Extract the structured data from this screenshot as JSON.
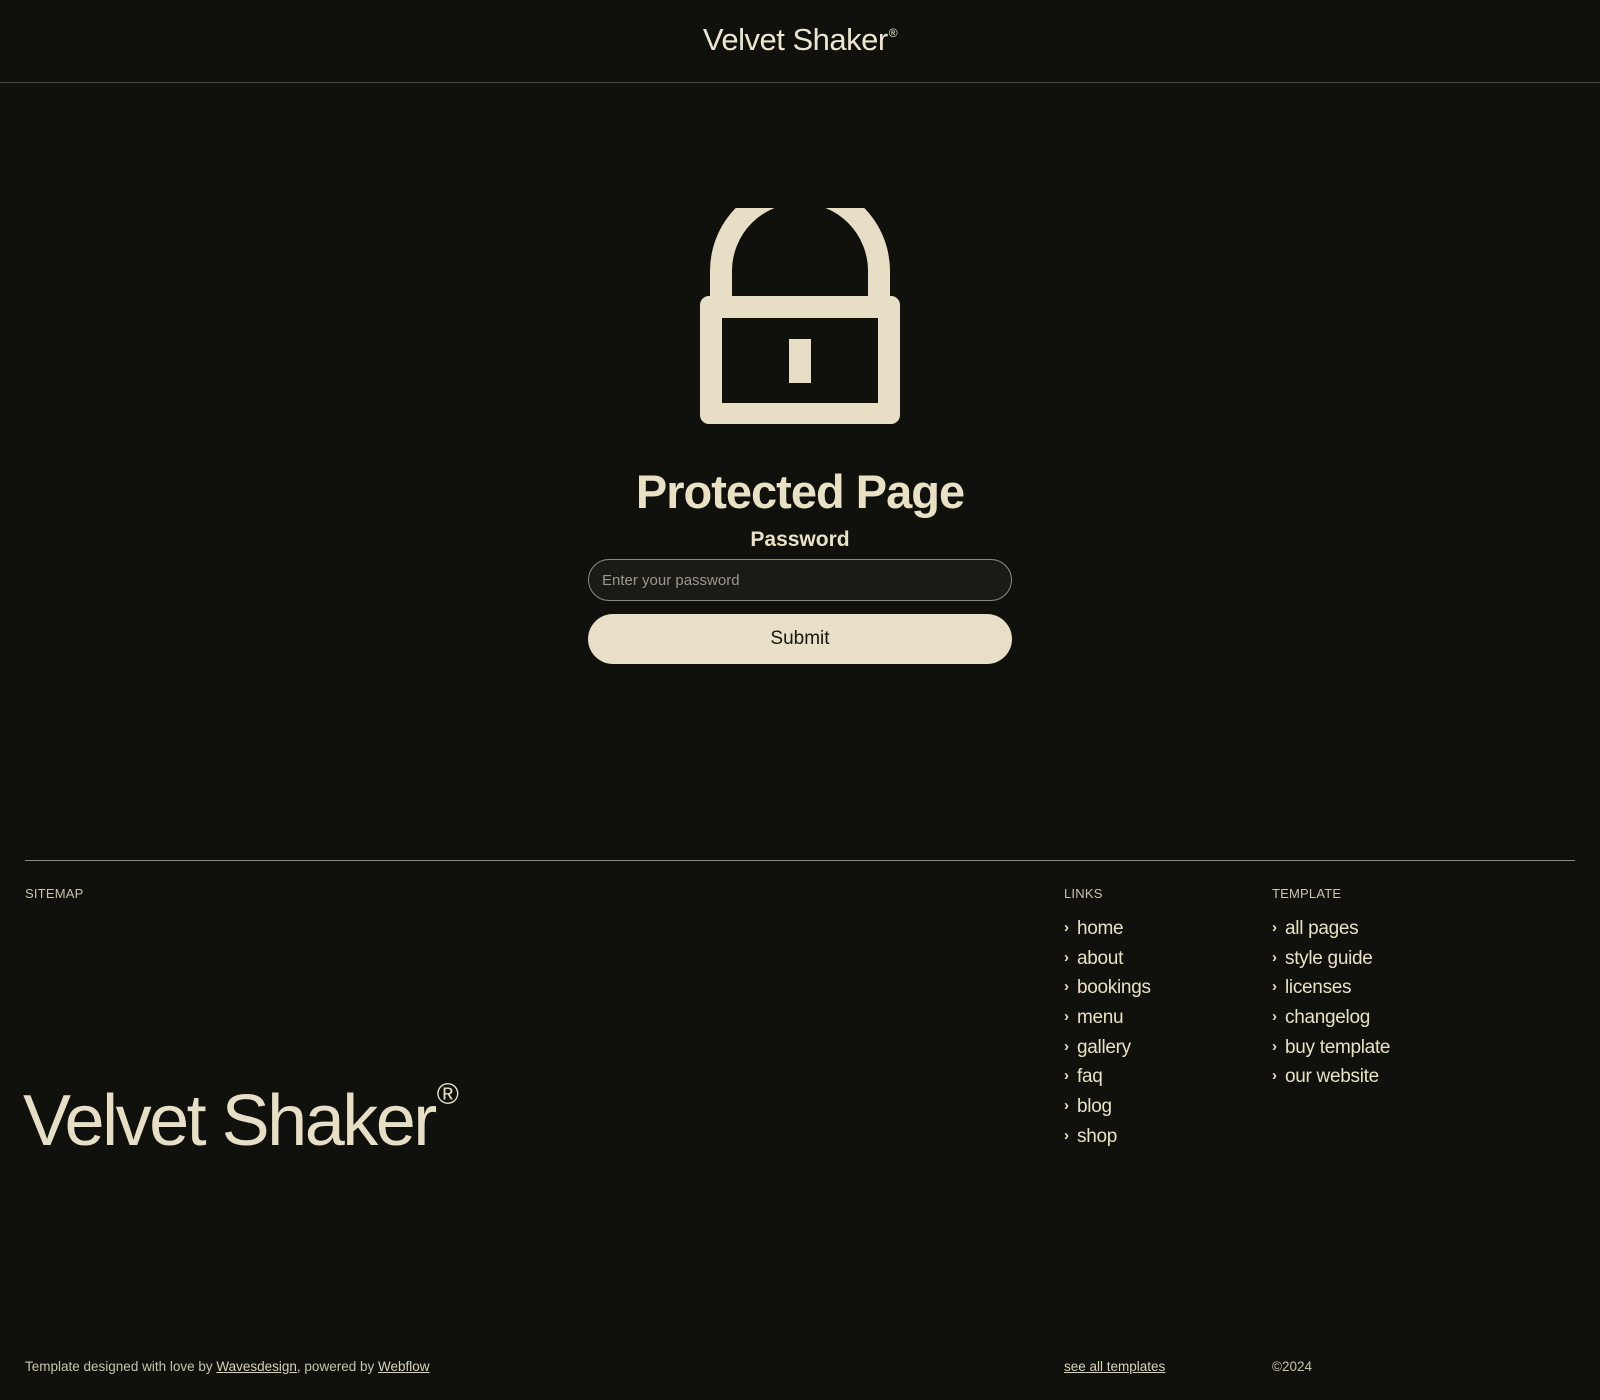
{
  "header": {
    "brand": "Velvet Shaker",
    "reg_mark": "®"
  },
  "lock": {
    "icon": "lock-icon",
    "color": "#e6dfc6"
  },
  "form": {
    "title": "Protected Page",
    "password_label": "Password",
    "password_placeholder": "Enter your password",
    "password_value": "",
    "submit_label": "Submit"
  },
  "footer": {
    "sitemap_heading": "SITEMAP",
    "links_heading": "LINKS",
    "template_heading": "TEMPLATE",
    "links": [
      {
        "label": "home"
      },
      {
        "label": "about"
      },
      {
        "label": "bookings"
      },
      {
        "label": "menu"
      },
      {
        "label": "gallery"
      },
      {
        "label": "faq"
      },
      {
        "label": "blog"
      },
      {
        "label": "shop"
      }
    ],
    "template_links": [
      {
        "label": "all pages"
      },
      {
        "label": "style guide"
      },
      {
        "label": "licenses"
      },
      {
        "label": "changelog"
      },
      {
        "label": "buy template"
      },
      {
        "label": "our website"
      }
    ],
    "chevron": "›",
    "brand": "Velvet Shaker",
    "reg_mark": "®",
    "credits": {
      "prefix": "Template designed with love by ",
      "designer_link": "Wavesdesign",
      "middle": ", powered by ",
      "platform_link": "Webflow"
    },
    "see_all_templates": "see all templates",
    "copyright": "©2024"
  },
  "colors": {
    "background": "#10110d",
    "accent": "#e6dfc6",
    "divider": "#4a4b45"
  }
}
